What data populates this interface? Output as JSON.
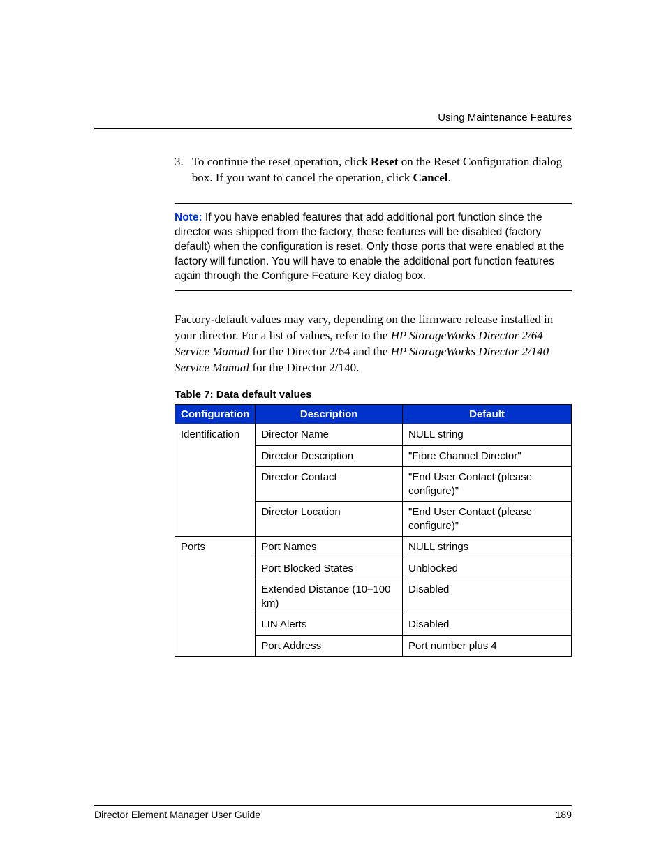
{
  "header": {
    "chapter": "Using Maintenance Features"
  },
  "step": {
    "number": "3.",
    "text_before_reset": "To continue the reset operation, click ",
    "reset": "Reset",
    "text_middle": " on the Reset Configuration dialog box. If you want to cancel the operation, click ",
    "cancel": "Cancel",
    "period": "."
  },
  "note": {
    "label": "Note:",
    "body": "  If you have enabled features that add additional port function since the director was shipped from the factory, these features will be disabled (factory default) when the configuration is reset. Only those ports that were enabled at the factory will function. You will have to enable the additional port function features again through the Configure Feature Key dialog box."
  },
  "para": {
    "p1": "Factory-default values may vary, depending on the firmware release installed in your director. For a list of values, refer to the ",
    "it1": "HP StorageWorks Director 2/64 Service Manual",
    "p2": " for the Director 2/64 and the ",
    "it2": "HP StorageWorks Director 2/140 Service Manual",
    "p3": " for the Director 2/140."
  },
  "table": {
    "caption": "Table 7:  Data default values",
    "headers": {
      "c1": "Configuration",
      "c2": "Description",
      "c3": "Default"
    },
    "rows": [
      {
        "config": "Identification",
        "desc": "Director Name",
        "def": "NULL string"
      },
      {
        "config": "",
        "desc": "Director Description",
        "def": "\"Fibre Channel Director\""
      },
      {
        "config": "",
        "desc": "Director Contact",
        "def": "\"End User Contact (please configure)\""
      },
      {
        "config": "",
        "desc": "Director Location",
        "def": "\"End User Contact (please configure)\""
      },
      {
        "config": "Ports",
        "desc": "Port Names",
        "def": "NULL strings"
      },
      {
        "config": "",
        "desc": "Port Blocked States",
        "def": "Unblocked"
      },
      {
        "config": "",
        "desc": "Extended Distance (10–100 km)",
        "def": "Disabled"
      },
      {
        "config": "",
        "desc": "LIN Alerts",
        "def": "Disabled"
      },
      {
        "config": "",
        "desc": "Port Address",
        "def": "Port number plus 4"
      }
    ]
  },
  "footer": {
    "title": "Director Element Manager User Guide",
    "page": "189"
  }
}
